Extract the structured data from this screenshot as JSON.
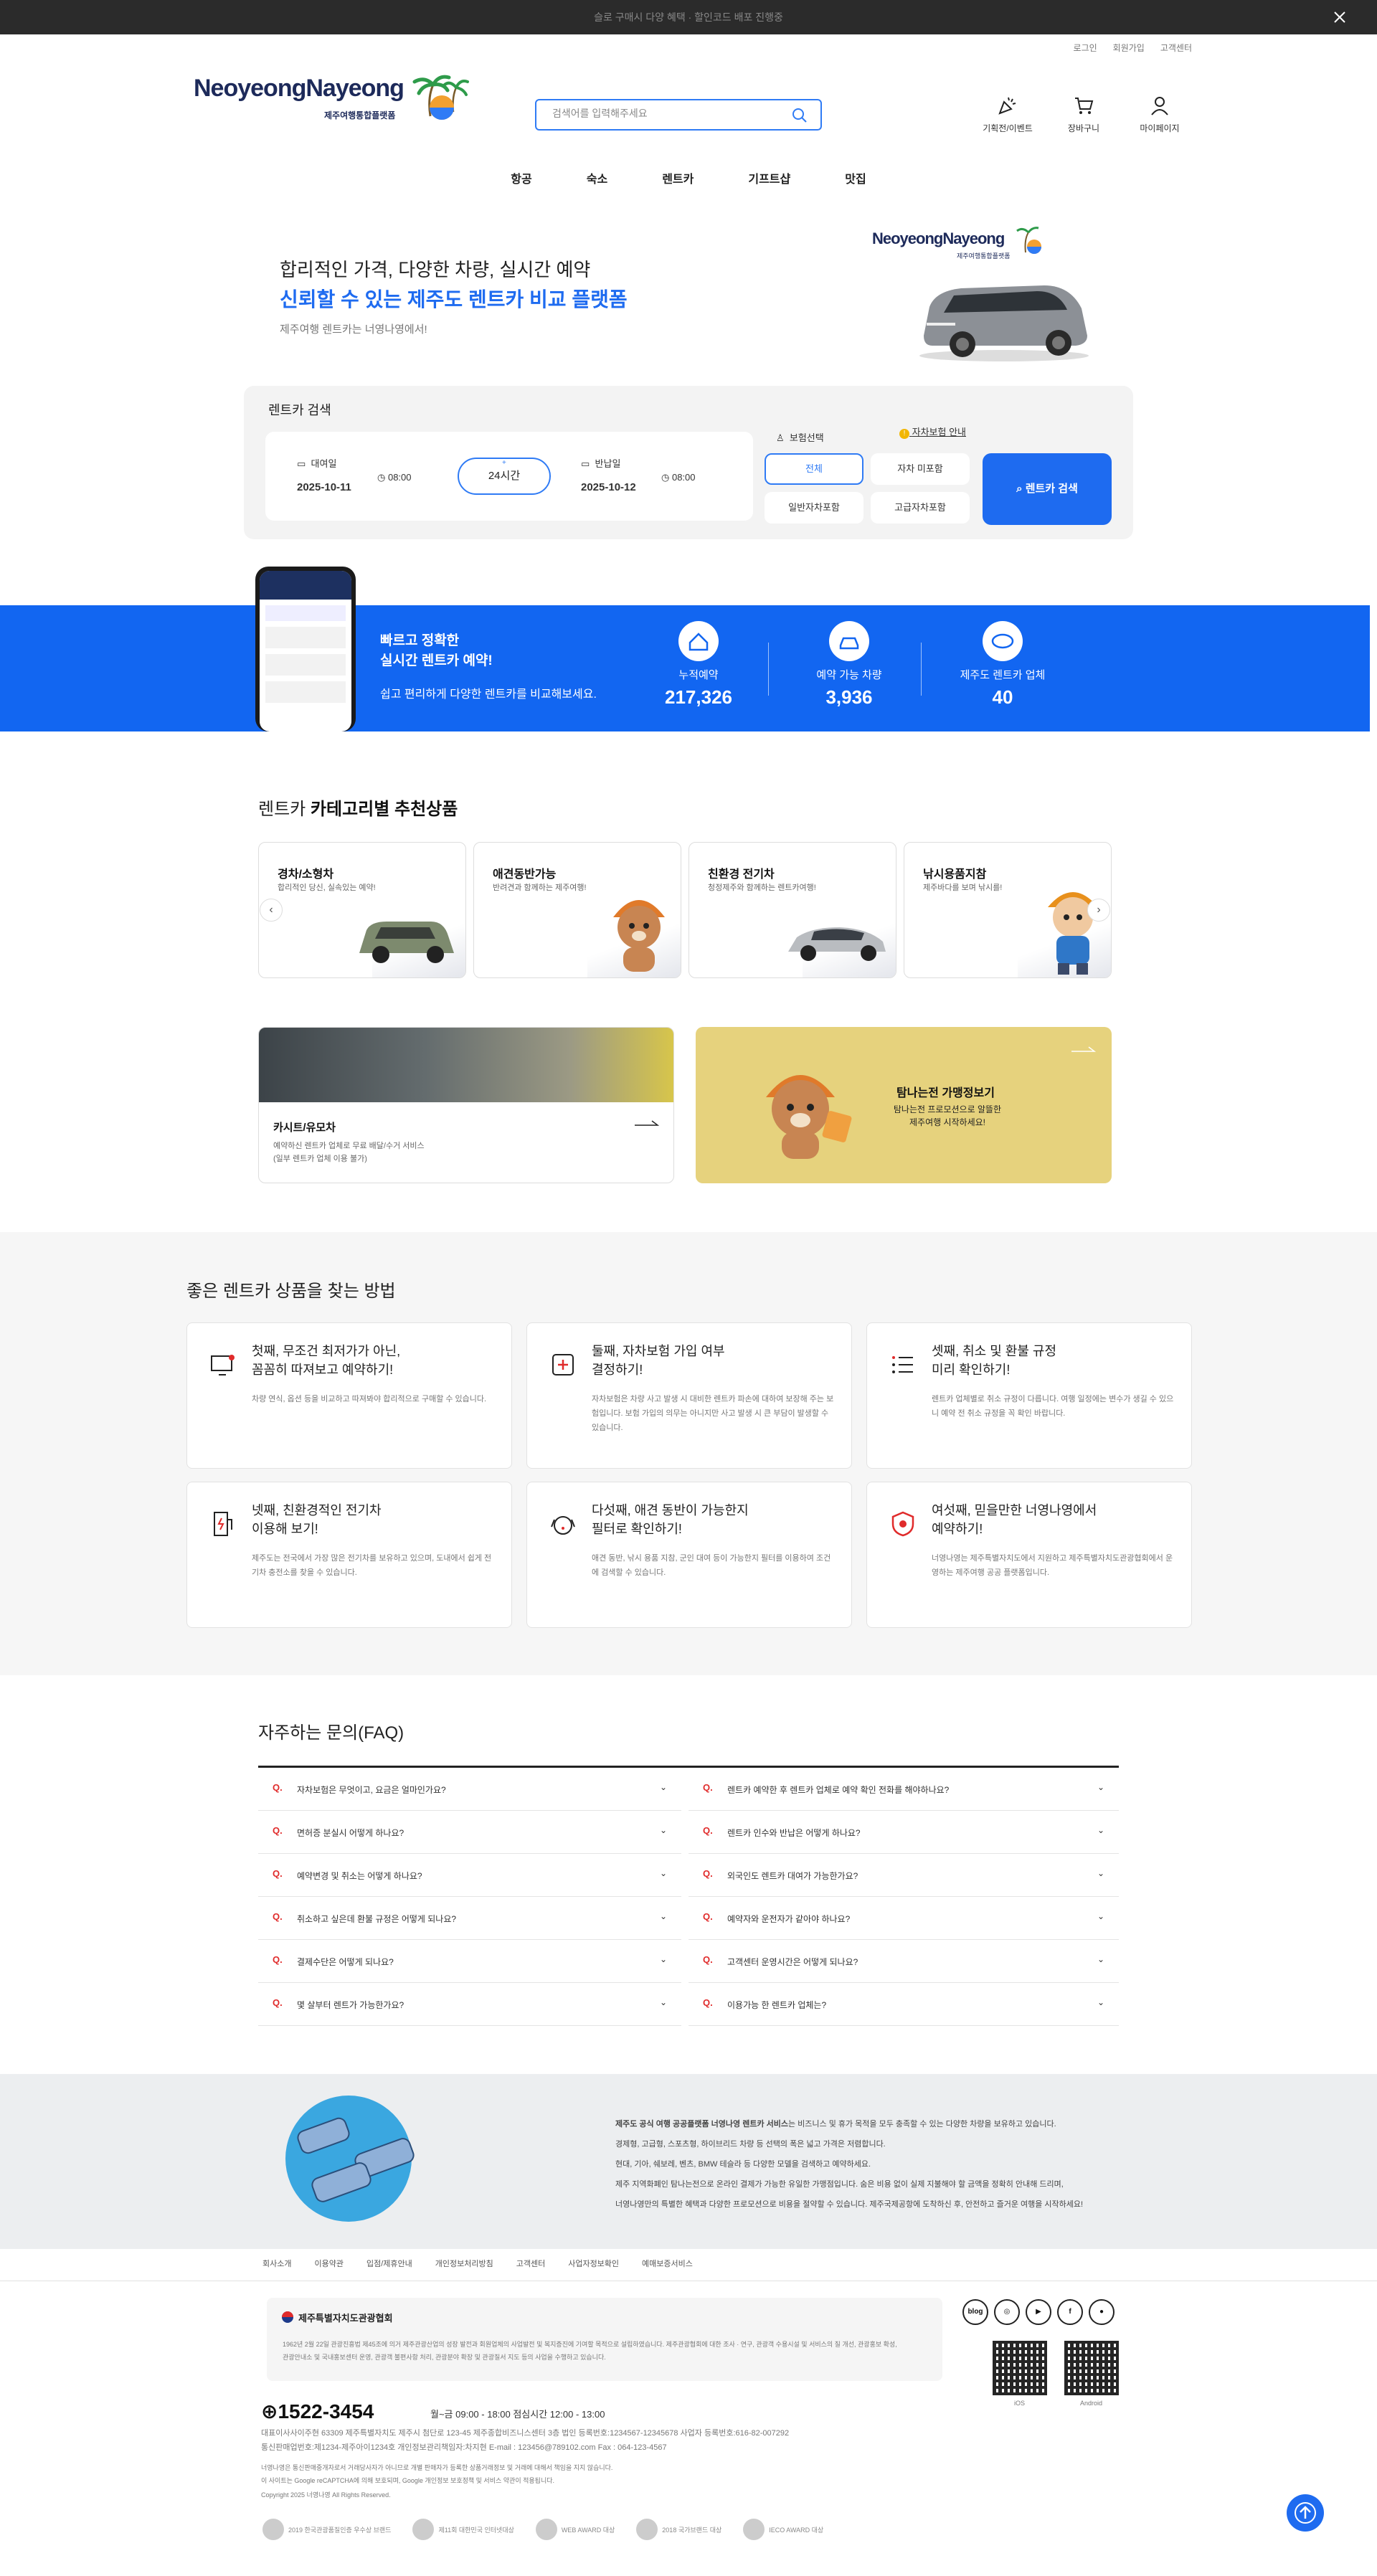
{
  "topbar": {
    "text": "슬로 구매시 다양 혜택 · 할인코드 배포 진행중"
  },
  "util": [
    "로그인",
    "회원가입",
    "고객센터"
  ],
  "logo": {
    "text": "NeoyeongNayeong",
    "sub": "제주여행통합플랫폼"
  },
  "search": {
    "placeholder": "검색어를 입력해주세요"
  },
  "header_icons": [
    {
      "label": "기획전/이벤트",
      "icon": "party-icon"
    },
    {
      "label": "장바구니",
      "icon": "cart-icon"
    },
    {
      "label": "마이페이지",
      "icon": "user-icon"
    }
  ],
  "nav": [
    "항공",
    "숙소",
    "렌트카",
    "기프트샵",
    "맛집"
  ],
  "hero": {
    "line1": "합리적인 가격, 다양한 차량, 실시간 예약",
    "line2": "신뢰할 수 있는 제주도 렌트카 비교 플랫폼",
    "line3": "제주여행 렌트카는 너영나영에서!",
    "logo_text": "NeoyeongNayeong",
    "logo_sub": "제주여행통합플랫폼"
  },
  "rent_search": {
    "title": "렌트카 검색",
    "pickup_label": "대여일",
    "pickup_date": "2025-10-11",
    "pickup_time": "08:00",
    "duration": "24시간",
    "return_label": "반납일",
    "return_date": "2025-10-12",
    "return_time": "08:00",
    "insurance_label": "보험선택",
    "insurance_info": "자차보험 안내",
    "insurance_options": [
      "전체",
      "자차 미포함",
      "일반자차포함",
      "고급자차포함"
    ],
    "submit": "렌트카 검색"
  },
  "band": {
    "title1": "빠르고 정확한",
    "title2": "실시간 렌트카 예약!",
    "desc": "쉽고 편리하게 다양한 렌트카를 비교해보세요.",
    "stats": [
      {
        "label": "누적예약",
        "value": "217,326"
      },
      {
        "label": "예약 가능 차량",
        "value": "3,936"
      },
      {
        "label": "제주도 렌트카 업체",
        "value": "40"
      }
    ]
  },
  "categories": {
    "title_light": "렌트카",
    "title_bold": "카테고리별 추천상품",
    "cards": [
      {
        "title": "경차/소형차",
        "desc": "합리적인 당신, 실속있는 예약!"
      },
      {
        "title": "애견동반가능",
        "desc": "반려견과 함께하는 제주여행!"
      },
      {
        "title": "친환경 전기차",
        "desc": "청정제주와 함께하는 렌트카여행!"
      },
      {
        "title": "낚시용품지참",
        "desc": "제주바다를 보며 낚시를!"
      }
    ]
  },
  "promos": {
    "p1_title": "카시트/유모차",
    "p1_desc1": "예약하신 렌트카 업체로 무료 배달/수거 서비스",
    "p1_desc2": "(일부 렌트카 업체 이용 불가)",
    "p2_title": "탐나는전 가맹정보기",
    "p2_desc1": "탐나는전 프로모션으로 알뜰한",
    "p2_desc2": "제주여행 시작하세요!"
  },
  "how": {
    "title": "좋은 렌트카 상품을 찾는 방법",
    "cards": [
      {
        "t1": "첫째, 무조건 최저가가 아닌,",
        "t2": "꼼꼼히 따져보고 예약하기!",
        "desc": "차량 연식, 옵션 등을 비교하고 따져봐야 합리적으로 구매할 수 있습니다."
      },
      {
        "t1": "둘째, 자차보험 가입 여부",
        "t2": "결정하기!",
        "desc": "자차보험은 차량 사고 발생 시 대비한 렌트카 파손에 대하여 보장해 주는 보험입니다. 보험 가입의 의무는 아니지만 사고 발생 시 큰 부담이 발생할 수 있습니다."
      },
      {
        "t1": "셋째, 취소 및 환불 규정",
        "t2": "미리 확인하기!",
        "desc": "렌트카 업체별로 취소 규정이 다릅니다. 여행 일정에는 변수가 생길 수 있으니 예약 전 취소 규정을 꼭 확인 바랍니다."
      },
      {
        "t1": "넷째, 친환경적인 전기차",
        "t2": "이용해 보기!",
        "desc": "제주도는 전국에서 가장 많은 전기차를 보유하고 있으며, 도내에서 쉽게 전기차 충전소를 찾을 수 있습니다."
      },
      {
        "t1": "다섯째, 애견 동반이 가능한지",
        "t2": "필터로 확인하기!",
        "desc": "애견 동반, 낚시 용품 지참, 군인 대여 등이 가능한지 필터를 이용하여 조건에 검색할 수 있습니다."
      },
      {
        "t1": "여섯째, 믿을만한 너영나영에서",
        "t2": "예약하기!",
        "desc": "너영나영는 제주특별자치도에서 지원하고 제주특별자치도관광협회에서 운영하는 제주여행 공공 플랫폼입니다."
      }
    ]
  },
  "faq": {
    "title": "자주하는 문의(FAQ)",
    "left": [
      "자차보험은 무엇이고, 요금은 얼마인가요?",
      "면허증 분실시 어떻게 하나요?",
      "예약변경 및 취소는 어떻게 하나요?",
      "취소하고 싶은데 환불 규정은 어떻게 되나요?",
      "결제수단은 어떻게 되나요?",
      "몇 살부터 렌트가 가능한가요?"
    ],
    "right": [
      "렌트카 예약한 후 렌트카 업체로 예약 확인 전화를 해야하나요?",
      "렌트카 인수와 반납은 어떻게 하나요?",
      "외국인도 렌트카 대여가 가능한가요?",
      "예약자와 운전자가 같아야 하나요?",
      "고객센터 운영시간은 어떻게 되나요?",
      "이용가능 한 렌트카 업체는?"
    ]
  },
  "about": {
    "lead": "제주도 공식 여행 공공플랫폼 너영나영 렌트카 서비스",
    "l1": "는 비즈니스 및 휴가 목적을 모두 충족할 수 있는 다양한 차량을 보유하고 있습니다.",
    "l2": "경제형, 고급형, 스포츠형, 하이브리드 차량 등 선택의 폭은 넓고 가격은 저렴합니다.",
    "l3": "현대, 기아, 쉐보레, 벤츠, BMW 테슬라 등 다양한 모델을 검색하고 예약하세요.",
    "l4": "제주 지역화폐인 탐나는전으로 온라인 결제가 가능한 유일한 가맹점입니다. 숨은 비용 없이 실제 지불해야 할 금액을 정확히 안내해 드리며,",
    "l5": "너영나영만의 특별한 혜택과 다양한 프로모션으로 비용을 절약할 수 있습니다. 제주국제공항에 도착하신 후, 안전하고 즐거운 여행을 시작하세요!"
  },
  "footer": {
    "links": [
      "회사소개",
      "이용약관",
      "입점/제휴안내",
      "개인정보처리방침",
      "고객센터",
      "사업자정보확인",
      "예매보증서비스"
    ],
    "assoc_title": "제주특별자치도관광협회",
    "assoc_desc": "1962년 2월 22일 관광진흥법 제45조에 의거 제주관광산업의 성장 발전과 회원업체의 사업발전 및 복지증진에 기여할 목적으로 설립하였습니다. 제주관광협회에 대한 조사 · 연구, 관광객 수용시설 및 서비스의 질 개선, 관광홍보 확성, 관광안내소 및 국내홍보센터 운영, 관광객 불편사항 처리, 관광분야 확장 및 관광질서 지도 등의 사업을 수행하고 있습니다.",
    "social": [
      "blog",
      "instagram",
      "youtube",
      "facebook",
      "talk"
    ],
    "qr_labels": [
      "iOS",
      "Android"
    ],
    "phone": "1522-3454",
    "hours": "월~금 09:00 - 18:00   점심시간 12:00 - 13:00",
    "info1": "대표이사사이주현    63309 제주특별자치도 제주시 첨단로 123-45 제주종합비즈니스센터 3층    법인 등록번호:1234567-12345678    사업자 등록번호:616-82-007292",
    "info2": "통신판매업번호:제1234-제주아이1234호    개인정보관리책임자:차지현    E-mail : 123456@789102.com    Fax : 064-123-4567",
    "info3": "너영나영은 통신판매중개자로서 거래당사자가 아니므로 개별 판매자가 등록한 상품거래정보 및 거래에 대해서 책임을 지지 않습니다.",
    "info4": "이 사이트는 Google reCAPTCHA에 의해 보호되며, Google 개인정보 보호정책 및 서비스 약관이 적용됩니다.",
    "copyright": "Copyright 2025 너영나영 All Rights Reserved.",
    "awards": [
      "2019 한국관광품질인증 우수상 브랜드",
      "제11회 대한민국 인터넷대상",
      "WEB AWARD 대상",
      "2018 국가브랜드 대상",
      "IECO AWARD 대상"
    ]
  }
}
